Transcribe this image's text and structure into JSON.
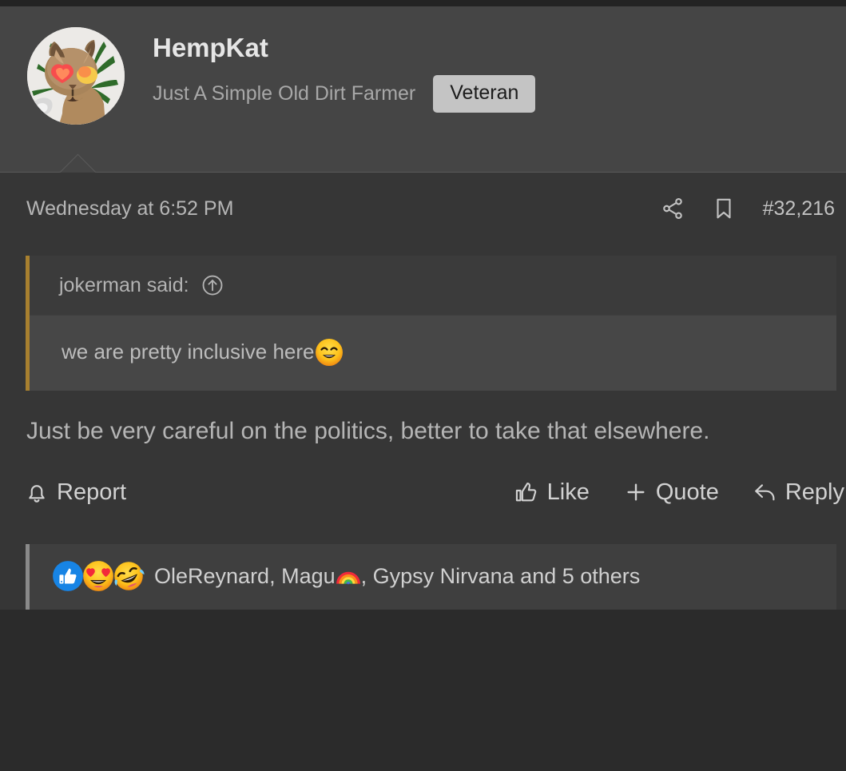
{
  "top_strip": {
    "color": "#232323"
  },
  "post": {
    "author": {
      "username": "HempKat",
      "user_title": "Just A Simple Old Dirt Farmer",
      "badge": "Veteran",
      "avatar_alt": "cat-with-heart-eyes-avatar"
    },
    "meta": {
      "date": "Wednesday at 6:52 PM",
      "share_icon": "share-icon",
      "bookmark_icon": "bookmark-icon",
      "post_number": "#32,216"
    },
    "quote": {
      "attribution": "jokerman said:",
      "jump_icon": "circled-up-arrow-icon",
      "text": "we are pretty inclusive here",
      "emoji": "smiling-face-with-smiling-eyes",
      "accent_color": "#a8802f"
    },
    "body": "Just be very careful on the politics, better to take that elsewhere.",
    "actions": {
      "report": {
        "label": "Report",
        "icon": "bell-icon"
      },
      "like": {
        "label": "Like",
        "icon": "thumbs-up-icon"
      },
      "quote": {
        "label": "Quote",
        "icon": "plus-icon"
      },
      "reply": {
        "label": "Reply",
        "icon": "reply-arrow-icon"
      }
    },
    "reactions": {
      "icons": [
        "like-thumbs-up",
        "smiling-face-with-heart-eyes",
        "rolling-on-the-floor-laughing"
      ],
      "text_before": "OleReynard, Magu",
      "inline_emoji": "rainbow",
      "text_after": ", Gypsy Nirvana and 5 others"
    }
  }
}
